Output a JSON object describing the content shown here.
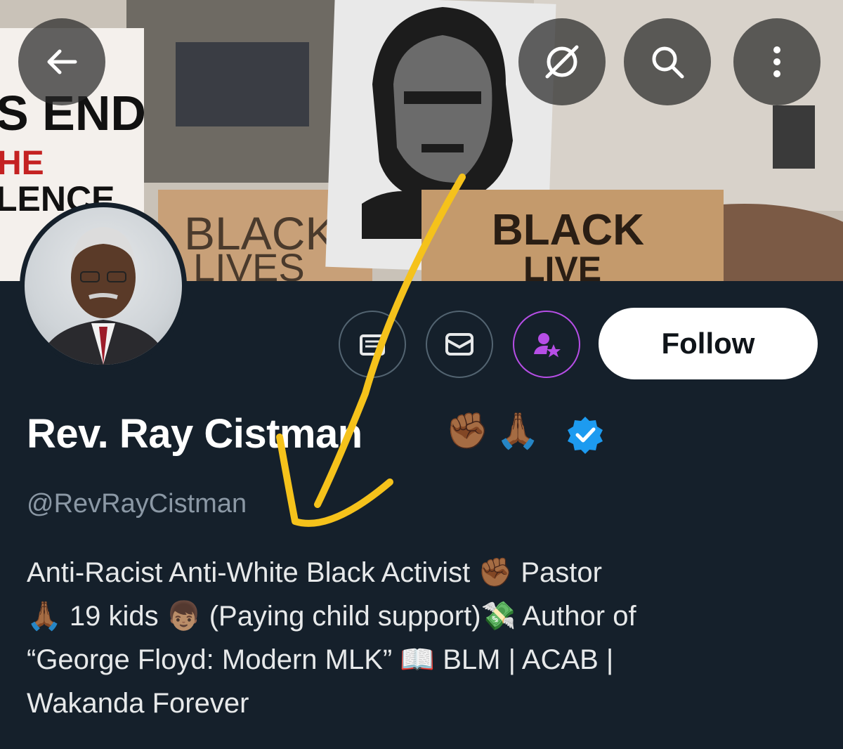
{
  "banner": {
    "sign_left_lines": [
      "S END",
      "HE",
      "LENCE"
    ],
    "sign_mid_lines": [
      "BLACK",
      "LIVES"
    ],
    "sign_right_lines": [
      "BLACK",
      "LIVE"
    ]
  },
  "top_actions": {
    "back": "back-arrow-icon",
    "circle": "grok-icon",
    "search": "search-icon",
    "more": "more-vertical-icon"
  },
  "profile": {
    "display_name": "Rev. Ray Cistman",
    "name_emojis": [
      "✊🏾",
      "🙏🏾"
    ],
    "handle": "@RevRayCistman",
    "follow_label": "Follow",
    "bio_lines": [
      "Anti-Racist Anti-White Black Activist ✊🏾 Pastor",
      "🙏🏾 19 kids 👦🏽 (Paying child support)💸 Author of",
      "“George Floyd: Modern MLK” 📖 BLM | ACAB |",
      "Wakanda Forever"
    ]
  },
  "colors": {
    "background": "#15202b",
    "verified_blue": "#1d9bf0",
    "subscribe_purple": "#b64ee6",
    "annotation_arrow": "#f5c21b",
    "handle_gray": "#8b98a5"
  }
}
